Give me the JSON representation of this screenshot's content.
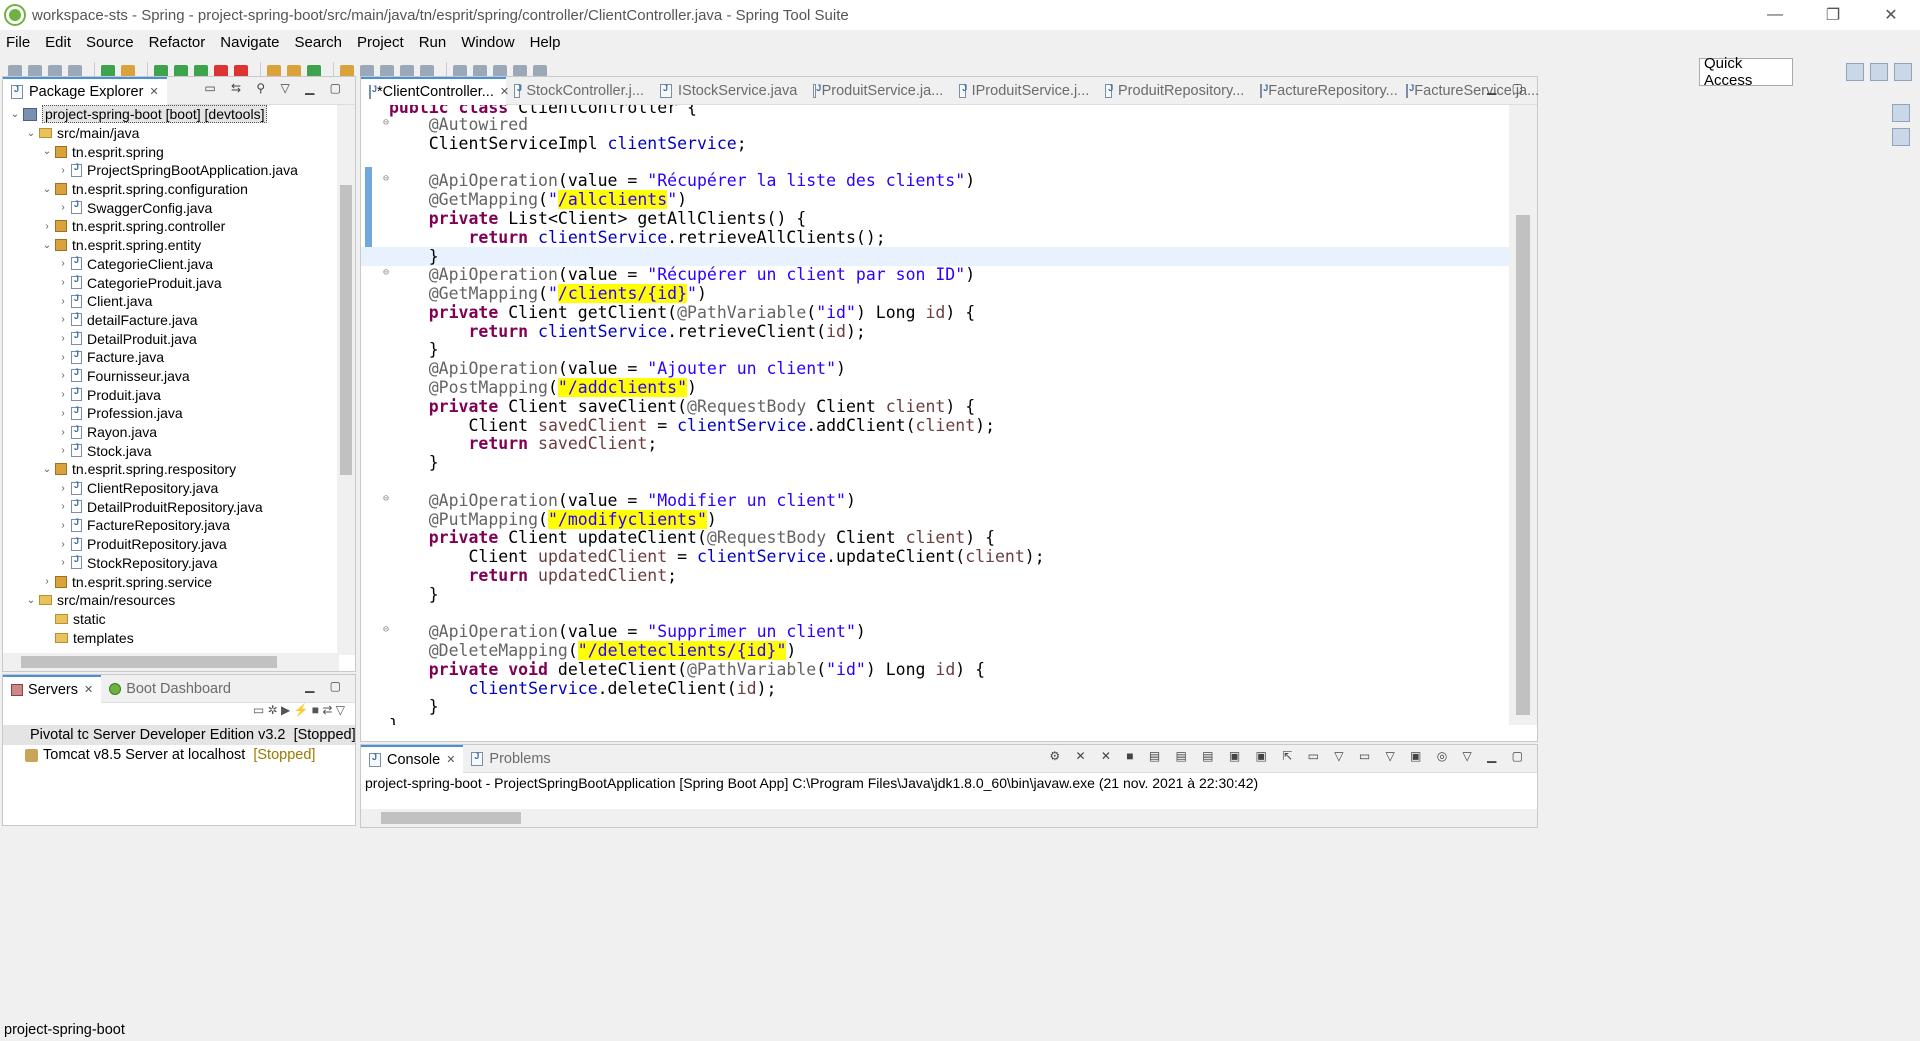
{
  "window": {
    "title": "workspace-sts - Spring - project-spring-boot/src/main/java/tn/esprit/spring/controller/ClientController.java - Spring Tool Suite"
  },
  "menu": [
    "File",
    "Edit",
    "Source",
    "Refactor",
    "Navigate",
    "Search",
    "Project",
    "Run",
    "Window",
    "Help"
  ],
  "toolbar": {
    "quick_access": "Quick Access"
  },
  "package_explorer": {
    "tab_label": "Package Explorer",
    "tree": [
      {
        "label": "project-spring-boot [boot] [devtools]",
        "kind": "project",
        "depth": 0,
        "arrow": "v",
        "selected": true
      },
      {
        "label": "src/main/java",
        "kind": "folder",
        "depth": 1,
        "arrow": "v"
      },
      {
        "label": "tn.esprit.spring",
        "kind": "package",
        "depth": 2,
        "arrow": "v"
      },
      {
        "label": "ProjectSpringBootApplication.java",
        "kind": "java",
        "depth": 3,
        "arrow": ">"
      },
      {
        "label": "tn.esprit.spring.configuration",
        "kind": "package",
        "depth": 2,
        "arrow": "v"
      },
      {
        "label": "SwaggerConfig.java",
        "kind": "java",
        "depth": 3,
        "arrow": ">"
      },
      {
        "label": "tn.esprit.spring.controller",
        "kind": "package",
        "depth": 2,
        "arrow": ">"
      },
      {
        "label": "tn.esprit.spring.entity",
        "kind": "package",
        "depth": 2,
        "arrow": "v"
      },
      {
        "label": "CategorieClient.java",
        "kind": "java",
        "depth": 3,
        "arrow": ">"
      },
      {
        "label": "CategorieProduit.java",
        "kind": "java",
        "depth": 3,
        "arrow": ">"
      },
      {
        "label": "Client.java",
        "kind": "java",
        "depth": 3,
        "arrow": ">"
      },
      {
        "label": "detailFacture.java",
        "kind": "java",
        "depth": 3,
        "arrow": ">"
      },
      {
        "label": "DetailProduit.java",
        "kind": "java",
        "depth": 3,
        "arrow": ">"
      },
      {
        "label": "Facture.java",
        "kind": "java",
        "depth": 3,
        "arrow": ">"
      },
      {
        "label": "Fournisseur.java",
        "kind": "java",
        "depth": 3,
        "arrow": ">"
      },
      {
        "label": "Produit.java",
        "kind": "java",
        "depth": 3,
        "arrow": ">"
      },
      {
        "label": "Profession.java",
        "kind": "java",
        "depth": 3,
        "arrow": ">"
      },
      {
        "label": "Rayon.java",
        "kind": "java",
        "depth": 3,
        "arrow": ">"
      },
      {
        "label": "Stock.java",
        "kind": "java",
        "depth": 3,
        "arrow": ">"
      },
      {
        "label": "tn.esprit.spring.respository",
        "kind": "package",
        "depth": 2,
        "arrow": "v"
      },
      {
        "label": "ClientRepository.java",
        "kind": "java",
        "depth": 3,
        "arrow": ">"
      },
      {
        "label": "DetailProduitRepository.java",
        "kind": "java",
        "depth": 3,
        "arrow": ">"
      },
      {
        "label": "FactureRepository.java",
        "kind": "java",
        "depth": 3,
        "arrow": ">"
      },
      {
        "label": "ProduitRepository.java",
        "kind": "java",
        "depth": 3,
        "arrow": ">"
      },
      {
        "label": "StockRepository.java",
        "kind": "java",
        "depth": 3,
        "arrow": ">"
      },
      {
        "label": "tn.esprit.spring.service",
        "kind": "package",
        "depth": 2,
        "arrow": ">"
      },
      {
        "label": "src/main/resources",
        "kind": "folder",
        "depth": 1,
        "arrow": "v"
      },
      {
        "label": "static",
        "kind": "folder",
        "depth": 2,
        "arrow": ""
      },
      {
        "label": "templates",
        "kind": "folder",
        "depth": 2,
        "arrow": ""
      }
    ]
  },
  "servers": {
    "tabs": [
      "Servers",
      "Boot Dashboard"
    ],
    "items": [
      {
        "name": "Pivotal tc Server Developer Edition v3.2",
        "state": "[Stopped]"
      },
      {
        "name": "Tomcat v8.5 Server at localhost",
        "state": "[Stopped]"
      }
    ]
  },
  "editor": {
    "tabs": [
      {
        "label": "*ClientController...",
        "active": true
      },
      {
        "label": "StockController.j...",
        "active": false
      },
      {
        "label": "IStockService.java",
        "active": false
      },
      {
        "label": "ProduitService.ja...",
        "active": false
      },
      {
        "label": "IProduitService.j...",
        "active": false
      },
      {
        "label": "ProduitRepository...",
        "active": false
      },
      {
        "label": "FactureRepository...",
        "active": false
      },
      {
        "label": "FactureService.ja...",
        "active": false
      }
    ]
  },
  "console": {
    "tabs": [
      "Console",
      "Problems"
    ],
    "description": "project-spring-boot - ProjectSpringBootApplication [Spring Boot App] C:\\Program Files\\Java\\jdk1.8.0_60\\bin\\javaw.exe (21 nov. 2021 à 22:30:42)"
  },
  "status_bar": {
    "text": "project-spring-boot"
  }
}
